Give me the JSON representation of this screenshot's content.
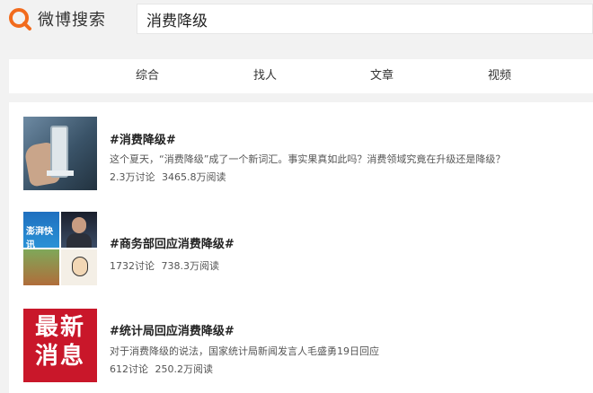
{
  "header": {
    "logo_text": "微博搜索",
    "search_value": "消费降级",
    "logo_color": "#f26b1d"
  },
  "tabs": [
    {
      "label": "综合"
    },
    {
      "label": "找人"
    },
    {
      "label": "文章"
    },
    {
      "label": "视频"
    }
  ],
  "results": [
    {
      "title": "#消费降级#",
      "description": "这个夏天，“消费降级”成了一个新词汇。事实果真如此吗？消费领域究竟在升级还是降级？",
      "discussions": "2.3万讨论",
      "reads": "3465.8万阅读"
    },
    {
      "title": "#商务部回应消费降级#",
      "description": "",
      "discussions": "1732讨论",
      "reads": "738.3万阅读",
      "thumb_caption": "澎湃快讯"
    },
    {
      "title": "#统计局回应消费降级#",
      "description": "对于消费降级的说法，国家统计局新闻发言人毛盛勇19日回应",
      "discussions": "612讨论",
      "reads": "250.2万阅读",
      "thumb_line1": "最新",
      "thumb_line2": "消息"
    }
  ]
}
